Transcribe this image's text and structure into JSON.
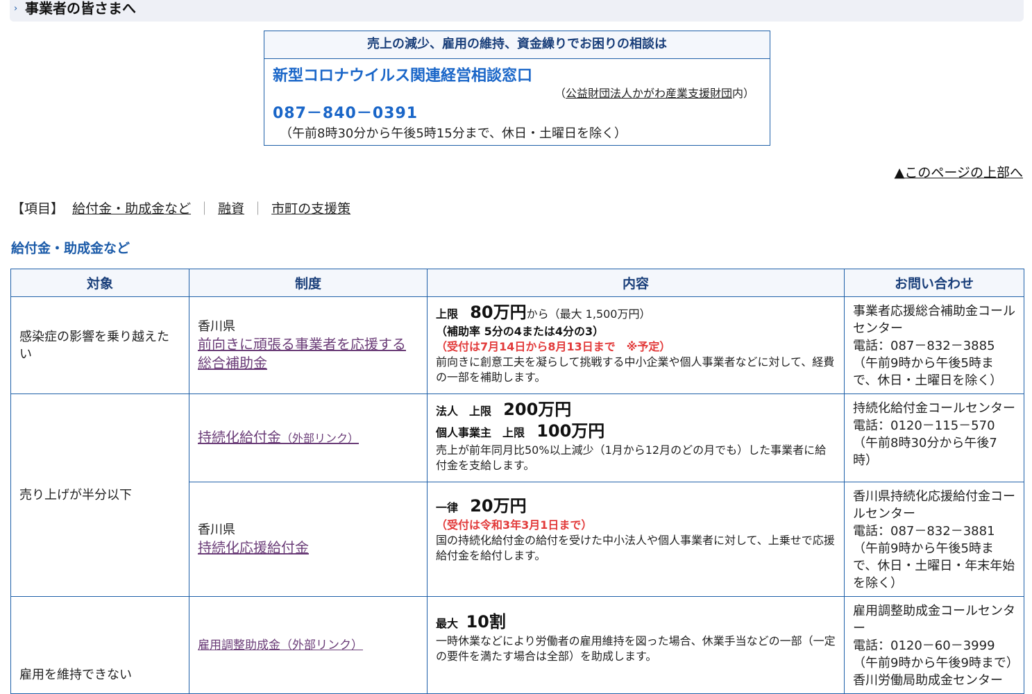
{
  "header": {
    "title": "事業者の皆さまへ"
  },
  "consult": {
    "heading": "売上の減少、雇用の維持、資金繰りでお困りの相談は",
    "name": "新型コロナウイルス関連経営相談窓口",
    "org_prefix": "（",
    "org_link": "公益財団法人かがわ産業支援財団",
    "org_suffix": "内）",
    "tel": "087－840－0391",
    "hours": "（午前8時30分から午後5時15分まで、休日・土曜日を除く）"
  },
  "page_top": "▲このページの上部へ",
  "toc": {
    "label": "【項目】",
    "items": [
      "給付金・助成金など",
      "融資",
      "市町の支援策"
    ],
    "separator": "｜"
  },
  "section_title": "給付金・助成金など",
  "table": {
    "headers": [
      "対象",
      "制度",
      "内容",
      "お問い合わせ"
    ],
    "rows": [
      {
        "target": "感染症の影響を乗り越えたい",
        "pref": "香川県",
        "system": "前向きに頑張る事業者を応援する総合補助金",
        "content": {
          "l1_label": "上限",
          "l1_amount": "80万円",
          "l1_suffix": "から（最大 1,500万円）",
          "l2": "（補助率 5分の4または4分の3）",
          "note": "（受付は7月14日から8月13日まで　※予定）",
          "desc": "前向きに創意工夫を凝らして挑戦する中小企業や個人事業者などに対して、経費の一部を補助します。"
        },
        "contact": {
          "name": "事業者応援総合補助金コールセンター",
          "tel": "電話：087－832－3885",
          "hours": "（午前9時から午後5時まで、休日・土曜日を除く）"
        }
      },
      {
        "target": "売り上げが半分以下",
        "system": "持続化給付金",
        "system_ext": "（外部リンク）",
        "content": {
          "l1_label": "法人　上限",
          "l1_amount": "200万円",
          "l2_label": "個人事業主　上限",
          "l2_amount": "100万円",
          "desc": "売上が前年同月比50%以上減少（1月から12月のどの月でも）した事業者に給付金を支給します。"
        },
        "contact": {
          "name": "持続化給付金コールセンター",
          "tel": "電話：0120－115－570",
          "hours": "（午前8時30分から午後7時）"
        }
      },
      {
        "pref": "香川県",
        "system": "持続化応援給付金",
        "content": {
          "l1_label": "一律",
          "l1_amount": "20万円",
          "note": "（受付は令和3年3月1日まで）",
          "desc": "国の持続化給付金の給付を受けた中小法人や個人事業者に対して、上乗せで応援給付金を給付します。"
        },
        "contact": {
          "name": "香川県持続化応援給付金コールセンター",
          "tel": "電話：087－832－3881",
          "hours": "（午前9時から午後5時まで、休日・土曜日・年末年始を除く）"
        }
      },
      {
        "target": "雇用を維持できない",
        "system": "雇用調整助成金（外部リンク）",
        "content": {
          "l1_label": "最大",
          "l1_amount": "10割",
          "desc": "一時休業などにより労働者の雇用維持を図った場合、休業手当などの一部（一定の要件を満たす場合は全部）を助成します。"
        },
        "contact": {
          "name": "雇用調整助成金コールセンター",
          "tel": "電話：0120－60－3999",
          "hours": "（午前9時から午後9時まで）",
          "next": "香川労働局助成金センター"
        }
      }
    ]
  }
}
